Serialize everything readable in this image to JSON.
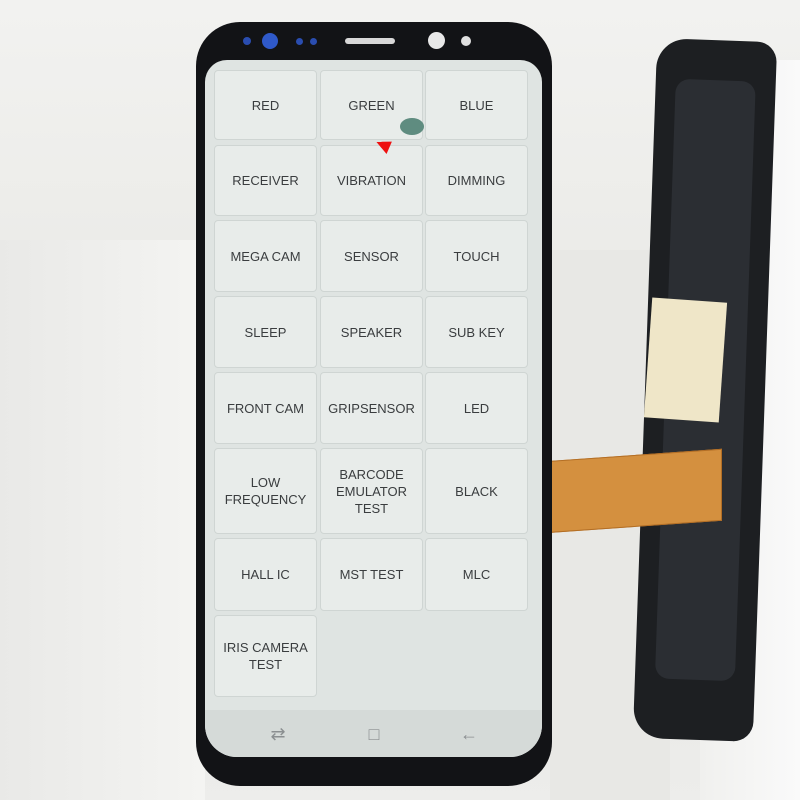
{
  "colors": {
    "screen": "#dfe4e2",
    "tile": "#e8ecea",
    "text": "#3a3d3f",
    "phone_body": "#121316",
    "cable": "#d4903f",
    "pointer": "#ee1111"
  },
  "tests": [
    {
      "label": "RED"
    },
    {
      "label": "GREEN"
    },
    {
      "label": "BLUE"
    },
    {
      "label": "RECEIVER"
    },
    {
      "label": "VIBRATION"
    },
    {
      "label": "DIMMING"
    },
    {
      "label": "MEGA CAM"
    },
    {
      "label": "SENSOR"
    },
    {
      "label": "TOUCH"
    },
    {
      "label": "SLEEP"
    },
    {
      "label": "SPEAKER"
    },
    {
      "label": "SUB KEY"
    },
    {
      "label": "FRONT CAM"
    },
    {
      "label": "GRIPSENSOR"
    },
    {
      "label": "LED"
    },
    {
      "label": "LOW FREQUENCY"
    },
    {
      "label": "BARCODE EMULATOR TEST"
    },
    {
      "label": "BLACK"
    },
    {
      "label": "HALL IC"
    },
    {
      "label": "MST TEST"
    },
    {
      "label": "MLC"
    },
    {
      "label": "IRIS CAMERA TEST"
    }
  ],
  "navbar": {
    "recents_icon": "recents-icon",
    "home_icon": "home-icon",
    "back_icon": "back-arrow-icon"
  }
}
